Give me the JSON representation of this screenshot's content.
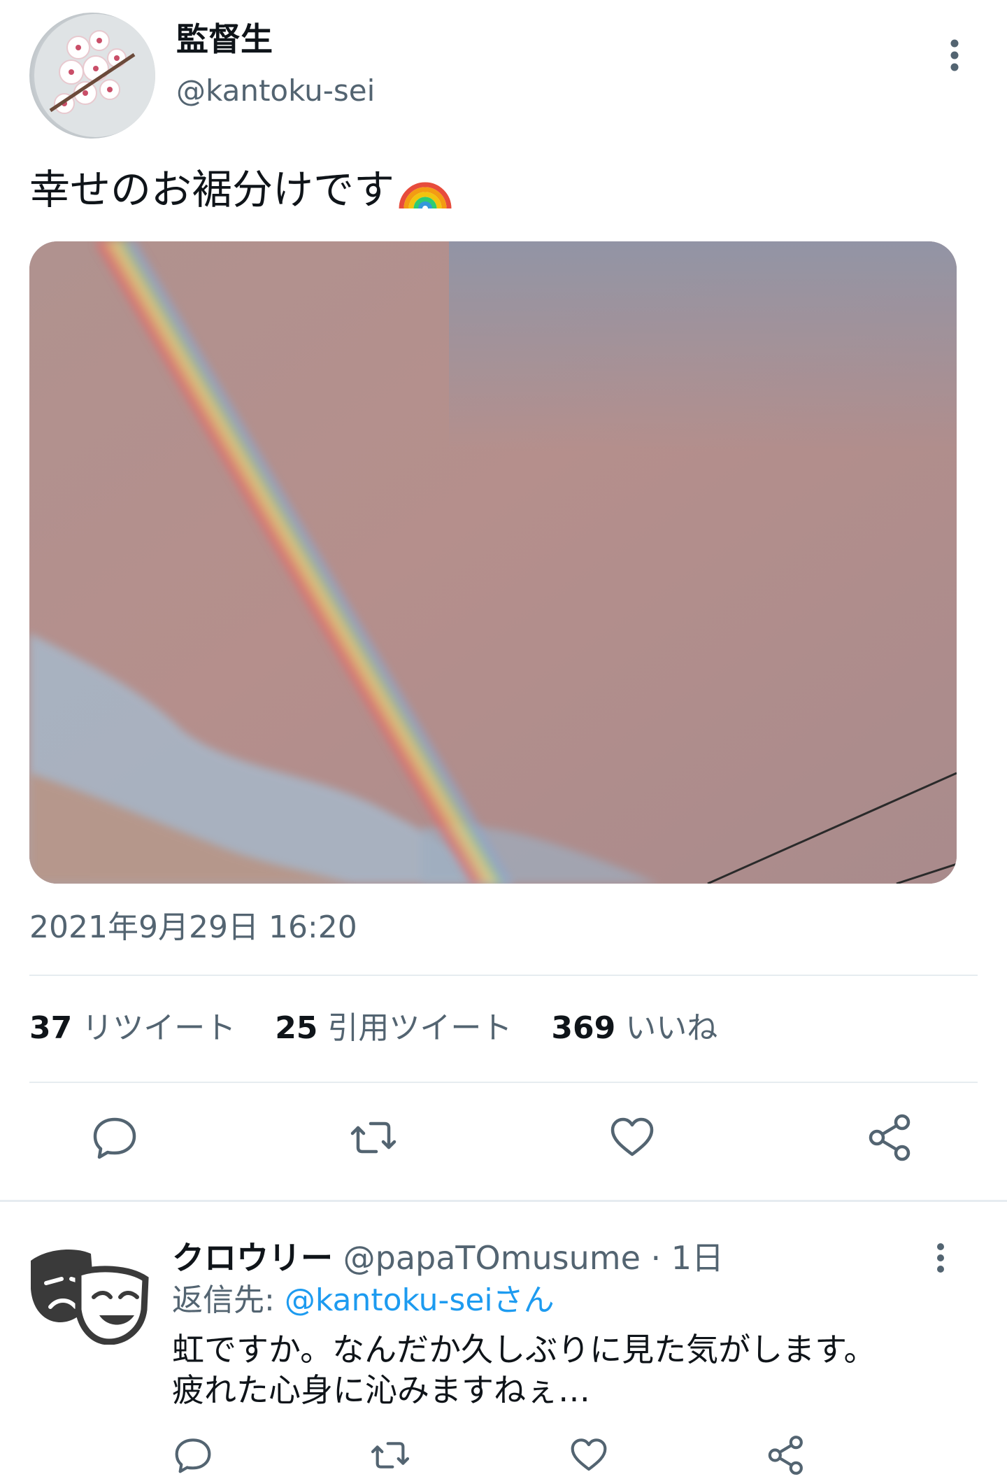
{
  "tweet": {
    "author_name": "監督生",
    "author_handle": "@kantoku-sei",
    "text": "幸せのお裾分けです",
    "emoji": "rainbow",
    "timestamp": "2021年9月29日 16:20",
    "stats": [
      {
        "count": "37",
        "label": "リツイート"
      },
      {
        "count": "25",
        "label": "引用ツイート"
      },
      {
        "count": "369",
        "label": "いいね"
      }
    ],
    "actions": [
      "reply-icon",
      "retweet-icon",
      "like-icon",
      "share-icon"
    ]
  },
  "reply": {
    "author_name": "クロウリー",
    "author_handle": "@papaTOmusume",
    "time": "· 1日",
    "reply_to_prefix": "返信先: ",
    "reply_to_mention": "@kantoku-seiさん",
    "text_lines": [
      "虹ですか。なんだか久しぶりに見た気がします。",
      "疲れた心身に沁みますねぇ…"
    ]
  },
  "colors": {
    "accent": "#1d9bf0",
    "secondary_text": "#536471",
    "icon": "#536471",
    "divider": "#e6ecf0"
  }
}
